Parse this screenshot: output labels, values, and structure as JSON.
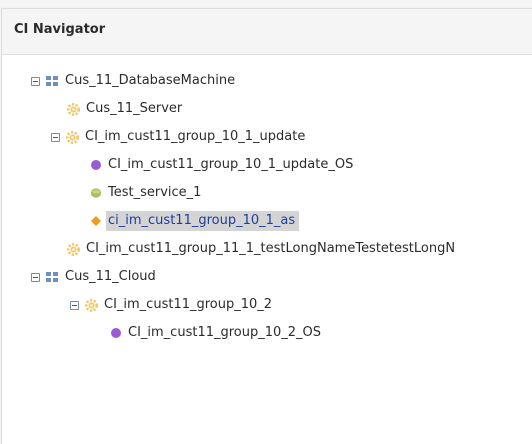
{
  "panel": {
    "title": "CI Navigator"
  },
  "tree": {
    "machine": {
      "label": "Cus_11_DatabaseMachine",
      "icon": "grid-icon",
      "expanded": true
    },
    "server": {
      "label": "Cus_11_Server",
      "icon": "gear-icon"
    },
    "group_update": {
      "label": "CI_im_cust11_group_10_1_update",
      "icon": "gear-icon",
      "expanded": true
    },
    "update_os": {
      "label": "CI_im_cust11_group_10_1_update_OS",
      "icon": "purple-dot-icon"
    },
    "test_service": {
      "label": "Test_service_1",
      "icon": "green-disc-icon"
    },
    "as_selected": {
      "label": "ci_im_cust11_group_10_1_as",
      "icon": "orange-diamond-icon",
      "selected": true
    },
    "group_long": {
      "label": "CI_im_cust11_group_11_1_testLongNameTestetestLongN",
      "icon": "gear-icon"
    },
    "cloud": {
      "label": "Cus_11_Cloud",
      "icon": "grid-icon",
      "expanded": true
    },
    "group_10_2": {
      "label": "CI_im_cust11_group_10_2",
      "icon": "gear-icon",
      "expanded": true
    },
    "group_10_2_os": {
      "label": "CI_im_cust11_group_10_2_OS",
      "icon": "purple-dot-icon"
    }
  },
  "colors": {
    "gear": "#f2c766",
    "grid": "#6e8fc4",
    "purple": "#9b5bd6",
    "green": "#a8c05a",
    "orange": "#f39a1c",
    "selected_text": "#1f3d99",
    "selected_bg": "#d4d4d4"
  }
}
